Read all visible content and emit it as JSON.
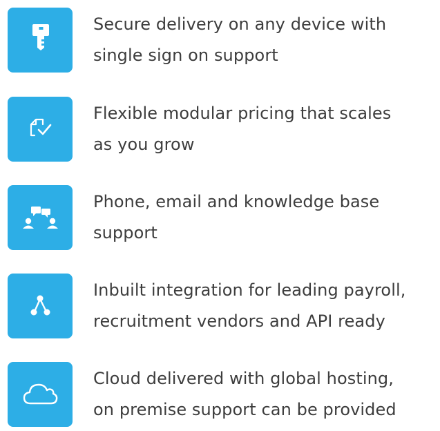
{
  "accent_color": "#2daee6",
  "text_color": "#3d3d3d",
  "features": [
    {
      "icon": "key-icon",
      "line1": "Secure delivery on any device with",
      "line2": "single sign on support"
    },
    {
      "icon": "document-check-icon",
      "line1": "Flexible modular pricing that scales",
      "line2": "as you grow"
    },
    {
      "icon": "support-chat-icon",
      "line1": "Phone, email and knowledge base",
      "line2": "support"
    },
    {
      "icon": "integration-icon",
      "line1": "Inbuilt integration for leading payroll,",
      "line2": "recruitment vendors and API ready"
    },
    {
      "icon": "cloud-icon",
      "line1": "Cloud delivered with global hosting,",
      "line2": "on premise support can be provided"
    }
  ]
}
